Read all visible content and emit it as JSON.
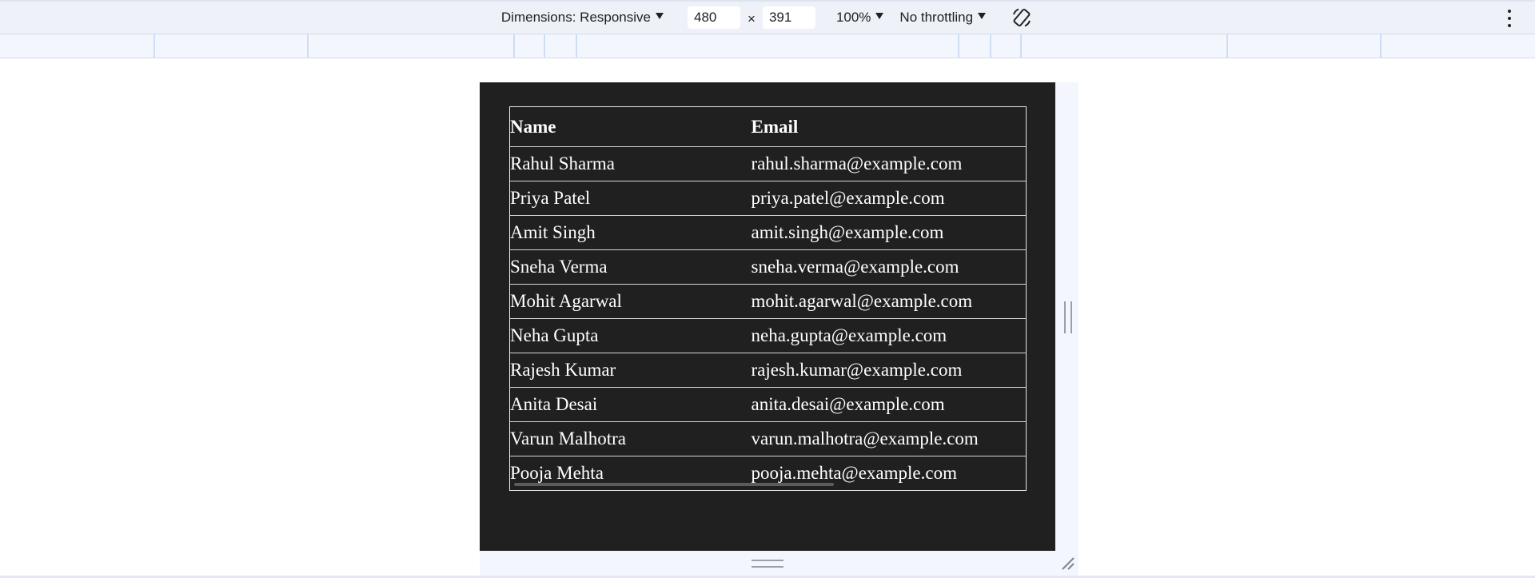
{
  "toolbar": {
    "dimensions_label": "Dimensions: Responsive",
    "width_value": "480",
    "times_symbol": "×",
    "height_value": "391",
    "zoom_label": "100%",
    "throttling_label": "No throttling"
  },
  "icons": {
    "rotate": "rotate-icon",
    "more": "more-options-icon"
  },
  "table": {
    "headers": {
      "name": "Name",
      "email": "Email"
    },
    "rows": [
      {
        "name": "Rahul Sharma",
        "email": "rahul.sharma@example.com"
      },
      {
        "name": "Priya Patel",
        "email": "priya.patel@example.com"
      },
      {
        "name": "Amit Singh",
        "email": "amit.singh@example.com"
      },
      {
        "name": "Sneha Verma",
        "email": "sneha.verma@example.com"
      },
      {
        "name": "Mohit Agarwal",
        "email": "mohit.agarwal@example.com"
      },
      {
        "name": "Neha Gupta",
        "email": "neha.gupta@example.com"
      },
      {
        "name": "Rajesh Kumar",
        "email": "rajesh.kumar@example.com"
      },
      {
        "name": "Anita Desai",
        "email": "anita.desai@example.com"
      },
      {
        "name": "Varun Malhotra",
        "email": "varun.malhotra@example.com"
      },
      {
        "name": "Pooja Mehta",
        "email": "pooja.mehta@example.com"
      }
    ]
  },
  "colors": {
    "page_background": "#202020",
    "text": "#ffffff",
    "toolbar_background": "#eef1f7"
  }
}
